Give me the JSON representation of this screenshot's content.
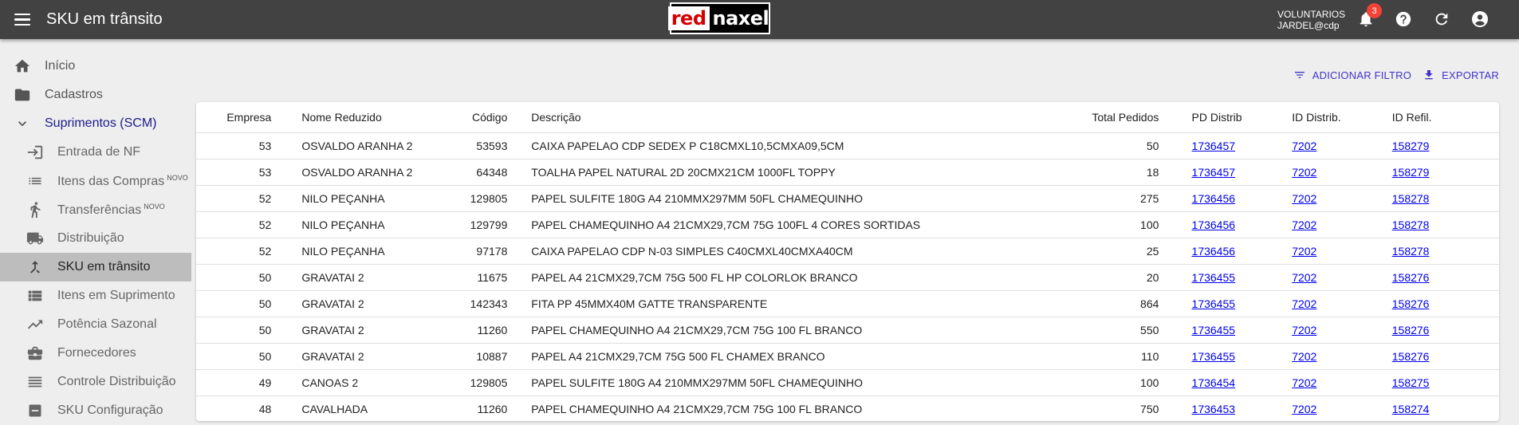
{
  "app": {
    "title": "SKU em trânsito",
    "logo_left": "red",
    "logo_right": "naxel",
    "user_line1": "VOLUNTARIOS",
    "user_line2": "JARDEL@cdp",
    "notification_count": "3"
  },
  "sidebar": {
    "items": [
      {
        "label": "Início",
        "icon": "home-icon"
      },
      {
        "label": "Cadastros",
        "icon": "folder-icon"
      },
      {
        "label": "Suprimentos (SCM)",
        "icon": "chevron-down-icon"
      },
      {
        "label": "Entrada de NF",
        "icon": "login-icon"
      },
      {
        "label": "Itens das Compras",
        "badge": "NOVO",
        "icon": "list-icon"
      },
      {
        "label": "Transferências",
        "badge": "NOVO",
        "icon": "transfer-walk-icon"
      },
      {
        "label": "Distribuição",
        "icon": "truck-icon"
      },
      {
        "label": "SKU em trânsito",
        "icon": "merge-icon"
      },
      {
        "label": "Itens em Suprimento",
        "icon": "view-list-icon"
      },
      {
        "label": "Potência Sazonal",
        "icon": "trending-up-icon"
      },
      {
        "label": "Fornecedores",
        "icon": "briefcase-icon"
      },
      {
        "label": "Controle Distribuição",
        "icon": "lines-icon"
      },
      {
        "label": "SKU Configuração",
        "icon": "config-icon"
      }
    ]
  },
  "actions": {
    "filter_label": "ADICIONAR FILTRO",
    "export_label": "EXPORTAR"
  },
  "table": {
    "headers": [
      "Empresa",
      "Nome Reduzido",
      "Código",
      "Descrição",
      "Total Pedidos",
      "PD Distrib",
      "ID Distrib.",
      "ID Refil."
    ],
    "rows": [
      [
        "53",
        "OSVALDO ARANHA 2",
        "53593",
        "CAIXA PAPELAO CDP SEDEX P C18CMXL10,5CMXA09,5CM",
        "50",
        "1736457",
        "7202",
        "158279"
      ],
      [
        "53",
        "OSVALDO ARANHA 2",
        "64348",
        "TOALHA PAPEL NATURAL 2D 20CMX21CM 1000FL TOPPY",
        "18",
        "1736457",
        "7202",
        "158279"
      ],
      [
        "52",
        "NILO PEÇANHA",
        "129805",
        "PAPEL SULFITE 180G A4 210MMX297MM 50FL CHAMEQUINHO",
        "275",
        "1736456",
        "7202",
        "158278"
      ],
      [
        "52",
        "NILO PEÇANHA",
        "129799",
        "PAPEL CHAMEQUINHO A4 21CMX29,7CM 75G 100FL 4 CORES SORTIDAS",
        "100",
        "1736456",
        "7202",
        "158278"
      ],
      [
        "52",
        "NILO PEÇANHA",
        "97178",
        "CAIXA PAPELAO CDP N-03 SIMPLES C40CMXL40CMXA40CM",
        "25",
        "1736456",
        "7202",
        "158278"
      ],
      [
        "50",
        "GRAVATAI 2",
        "11675",
        "PAPEL A4 21CMX29,7CM 75G 500 FL HP COLORLOK BRANCO",
        "20",
        "1736455",
        "7202",
        "158276"
      ],
      [
        "50",
        "GRAVATAI 2",
        "142343",
        "FITA PP 45MMX40M GATTE TRANSPARENTE",
        "864",
        "1736455",
        "7202",
        "158276"
      ],
      [
        "50",
        "GRAVATAI 2",
        "11260",
        "PAPEL CHAMEQUINHO A4 21CMX29,7CM 75G 100 FL BRANCO",
        "550",
        "1736455",
        "7202",
        "158276"
      ],
      [
        "50",
        "GRAVATAI 2",
        "10887",
        "PAPEL A4 21CMX29,7CM 75G 500 FL CHAMEX BRANCO",
        "110",
        "1736455",
        "7202",
        "158276"
      ],
      [
        "49",
        "CANOAS 2",
        "129805",
        "PAPEL SULFITE 180G A4 210MMX297MM 50FL CHAMEQUINHO",
        "100",
        "1736454",
        "7202",
        "158275"
      ],
      [
        "48",
        "CAVALHADA",
        "11260",
        "PAPEL CHAMEQUINHO A4 21CMX29,7CM 75G 100 FL BRANCO",
        "750",
        "1736453",
        "7202",
        "158274"
      ]
    ]
  },
  "colors": {
    "topbar": "#424242",
    "accent": "#3f35c8",
    "badge": "#f44336",
    "active_nav": "#bdbdbd",
    "link": "#0000ee"
  }
}
